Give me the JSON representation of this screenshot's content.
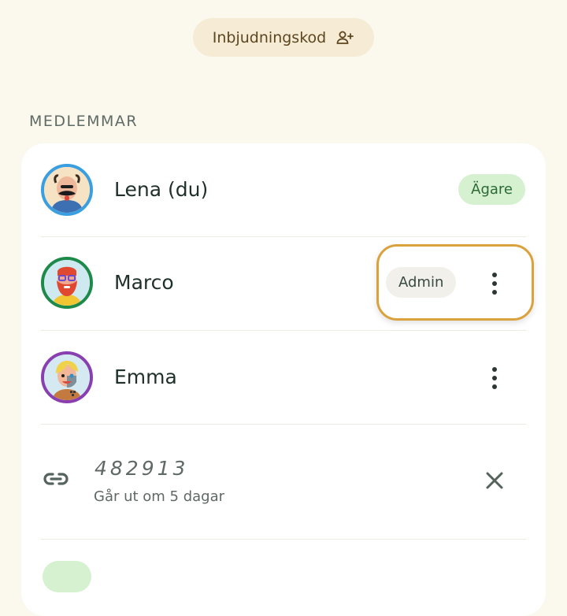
{
  "header": {
    "invite_label": "Inbjudningskod",
    "invite_icon": "person-add-icon"
  },
  "section": {
    "title": "MEDLEMMAR"
  },
  "members": [
    {
      "name": "Lena (du)",
      "badge": "Ägare",
      "avatar": "bald-man-avatar",
      "ring_color": "#3a9fe0"
    },
    {
      "name": "Marco",
      "badge": "Admin",
      "avatar": "red-beard-avatar",
      "ring_color": "#1e8a4a"
    },
    {
      "name": "Emma",
      "badge": "",
      "avatar": "blonde-avatar",
      "ring_color": "#8a3fb0"
    }
  ],
  "invite_code": {
    "code": "482913",
    "expires": "Går ut om 5 dagar",
    "icon": "link-icon",
    "remove_icon": "close-icon"
  },
  "colors": {
    "background": "#fbf8ee",
    "owner_badge": "#d6f1cf",
    "highlight": "#d9a23d"
  }
}
